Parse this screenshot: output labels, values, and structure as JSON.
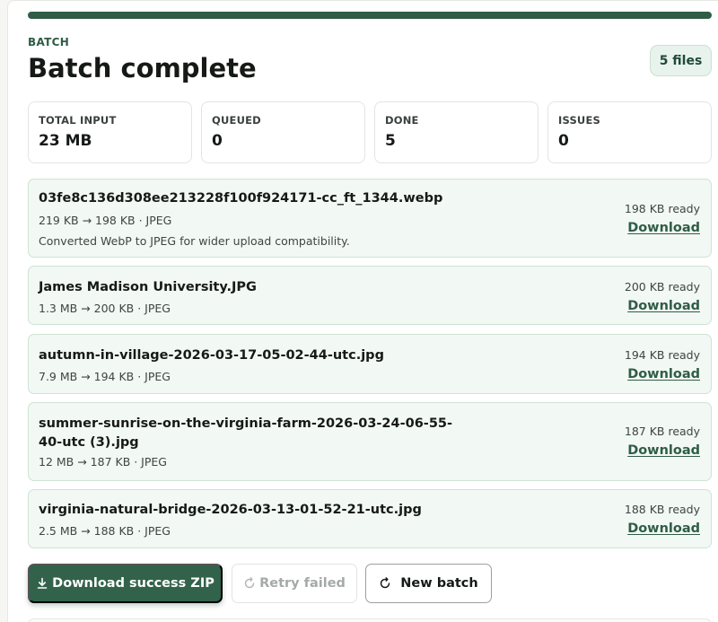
{
  "header": {
    "eyebrow": "BATCH",
    "title": "Batch complete",
    "file_count": "5 files"
  },
  "progress": {
    "fraction": 1.0,
    "color": "#2f5d46"
  },
  "stats": [
    {
      "label": "TOTAL INPUT",
      "value": "23 MB"
    },
    {
      "label": "QUEUED",
      "value": "0"
    },
    {
      "label": "DONE",
      "value": "5"
    },
    {
      "label": "ISSUES",
      "value": "0"
    }
  ],
  "files": [
    {
      "name": "03fe8c136d308ee213228f100f924171-cc_ft_1344.webp",
      "meta": "219 KB → 198 KB · JPEG",
      "note": "Converted WebP to JPEG for wider upload compatibility.",
      "status": "198 KB ready",
      "link": "Download"
    },
    {
      "name": "James Madison University.JPG",
      "meta": "1.3 MB → 200 KB · JPEG",
      "status": "200 KB ready",
      "link": "Download"
    },
    {
      "name": "autumn-in-village-2026-03-17-05-02-44-utc.jpg",
      "meta": "7.9 MB → 194 KB · JPEG",
      "status": "194 KB ready",
      "link": "Download"
    },
    {
      "name": "summer-sunrise-on-the-virginia-farm-2026-03-24-06-55-40-utc (3).jpg",
      "meta": "12 MB → 187 KB · JPEG",
      "status": "187 KB ready",
      "link": "Download"
    },
    {
      "name": "virginia-natural-bridge-2026-03-13-01-52-21-utc.jpg",
      "meta": "2.5 MB → 188 KB · JPEG",
      "status": "188 KB ready",
      "link": "Download"
    }
  ],
  "actions": {
    "download_zip": "Download success ZIP",
    "retry_failed": "Retry failed",
    "new_batch": "New batch",
    "download_icon": "download-icon",
    "retry_icon": "retry-icon",
    "refresh_icon": "refresh-icon"
  },
  "colors": {
    "accent": "#2f5d46",
    "card_bg": "#f2f8f4",
    "card_border": "#cfe3d6"
  }
}
